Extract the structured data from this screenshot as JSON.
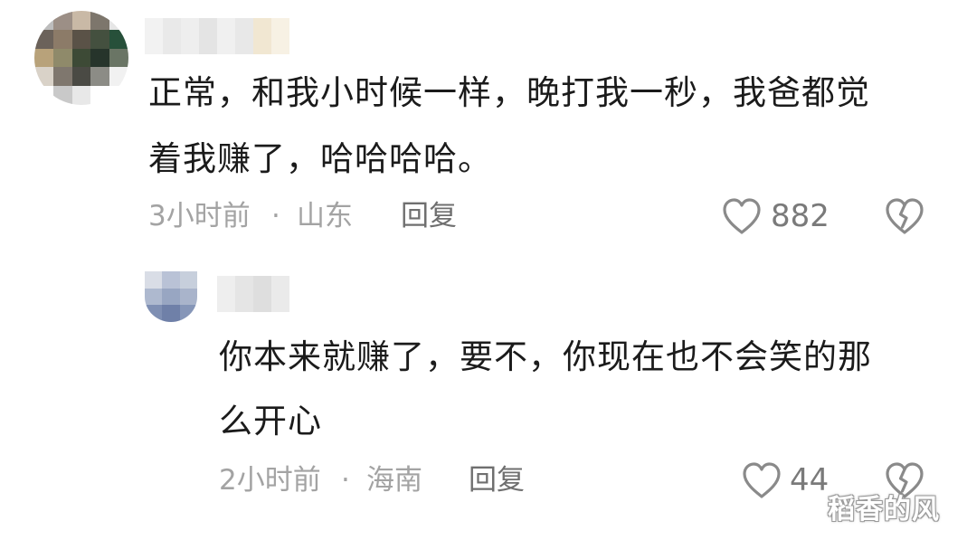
{
  "comment": {
    "text_line1": "正常，和我小时候一样，晚打我一秒，我爸都觉",
    "text_line2": "着我赚了，哈哈哈哈。",
    "time": "3小时前",
    "separator": "·",
    "location": "山东",
    "reply_label": "回复",
    "like_count": "882",
    "like_icon": "heart-outline-icon",
    "dislike_icon": "broken-heart-icon"
  },
  "reply": {
    "text_line1": "你本来就赚了，要不，你现在也不会笑的那",
    "text_line2": "么开心",
    "time": "2小时前",
    "separator": "·",
    "location": "海南",
    "reply_label": "回复",
    "like_count": "44",
    "like_icon": "heart-outline-icon",
    "dislike_icon": "broken-heart-icon"
  },
  "watermark": "稻香的风",
  "colors": {
    "text": "#1b1b1b",
    "meta": "#a3a3a3",
    "icon": "#8a8a8a"
  }
}
